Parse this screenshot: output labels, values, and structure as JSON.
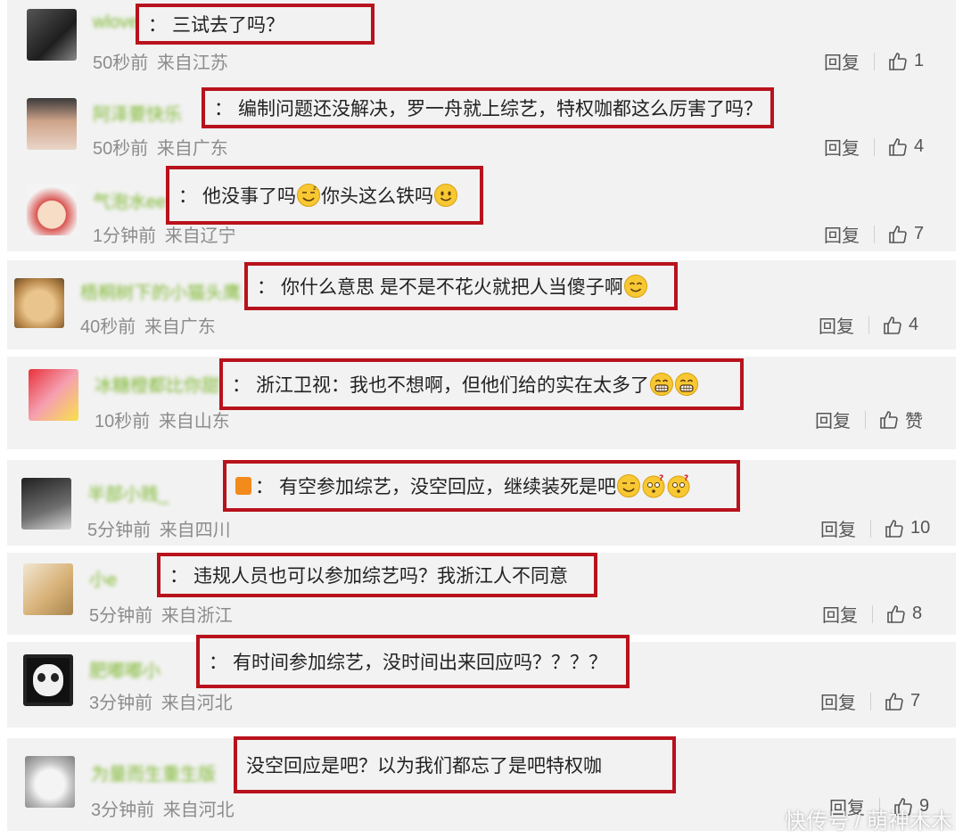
{
  "ui": {
    "reply_label": "回复",
    "emoji_label_smile": "smile-emoji"
  },
  "comments": [
    {
      "nick": "wlovengs",
      "text": "三试去了吗？",
      "time": "50秒前",
      "location": "来自江苏",
      "likes": "1"
    },
    {
      "nick": "阿泽要快乐",
      "text": "编制问题还没解决，罗一舟就上综艺，特权咖都这么厉害了吗？",
      "time": "50秒前",
      "location": "来自广东",
      "likes": "4"
    },
    {
      "nick": "气泡水ee",
      "text_a": "他没事了吗",
      "text_b": "你头这么铁吗",
      "time": "1分钟前",
      "location": "来自辽宁",
      "likes": "7"
    },
    {
      "nick": "梧桐树下的小猫头鹰",
      "text": "你什么意思 是不是不花火就把人当傻子啊",
      "time": "40秒前",
      "location": "来自广东",
      "likes": "4"
    },
    {
      "nick": "冰糖橙都比你甜",
      "text": "浙江卫视：我也不想啊，但他们给的实在太多了",
      "time": "10秒前",
      "location": "来自山东",
      "likes": "赞"
    },
    {
      "nick": "半部小贱_",
      "text": "有空参加综艺，没空回应，继续装死是吧",
      "time": "5分钟前",
      "location": "来自四川",
      "likes": "10"
    },
    {
      "nick": "小e",
      "text": "违规人员也可以参加综艺吗？我浙江人不同意",
      "time": "5分钟前",
      "location": "来自浙江",
      "likes": "8"
    },
    {
      "nick": "肥嘟嘟小",
      "text": "有时间参加综艺，没时间出来回应吗？？？？",
      "time": "3分钟前",
      "location": "来自河北",
      "likes": "7"
    },
    {
      "nick": "为量而生重生版",
      "text": "没空回应是吧？以为我们都忘了是吧特权咖",
      "time": "3分钟前",
      "location": "来自河北",
      "likes": "9"
    }
  ],
  "watermark": "快传号 / 萌神木木",
  "colors": {
    "frame_red": "#b8121c",
    "nick_green": "#7fb832",
    "card_bg": "#f2f2f2",
    "meta_gray": "#8c8c8c"
  }
}
